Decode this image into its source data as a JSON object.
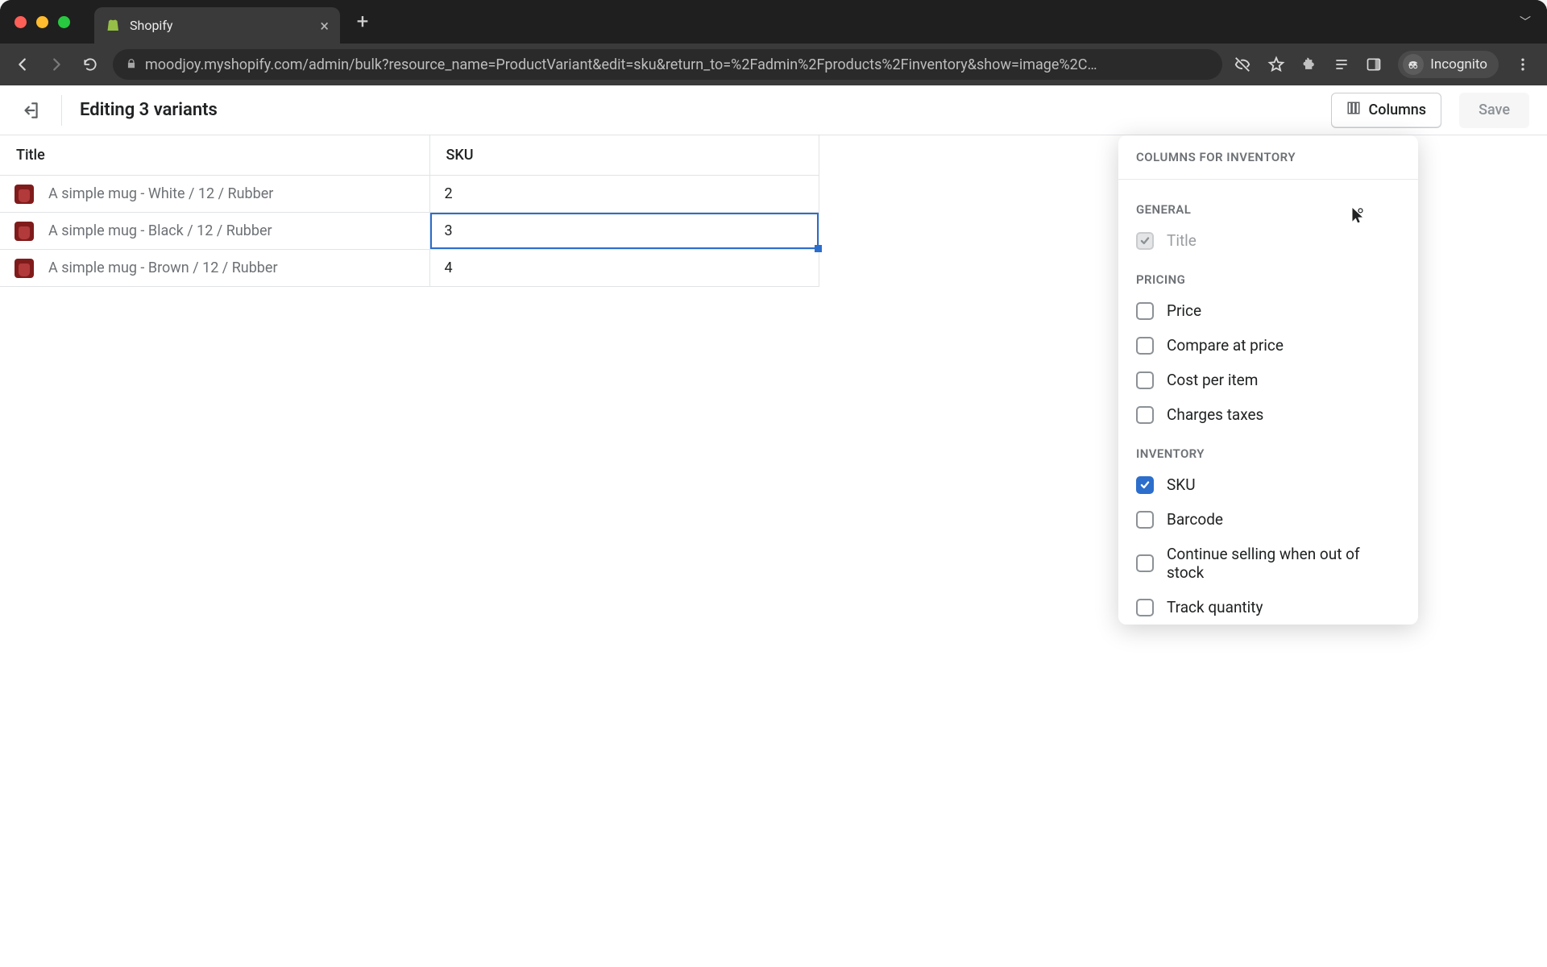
{
  "browser": {
    "tab_title": "Shopify",
    "url_display": "moodjoy.myshopify.com/admin/bulk?resource_name=ProductVariant&edit=sku&return_to=%2Fadmin%2Fproducts%2Finventory&show=image%2C…",
    "incognito_label": "Incognito"
  },
  "header": {
    "title": "Editing 3 variants",
    "columns_button": "Columns",
    "save_button": "Save"
  },
  "table": {
    "columns": {
      "title": "Title",
      "sku": "SKU"
    },
    "rows": [
      {
        "title": "A simple mug - White / 12 / Rubber",
        "sku": "2"
      },
      {
        "title": "A simple mug - Black / 12 / Rubber",
        "sku": "3"
      },
      {
        "title": "A simple mug - Brown / 12 / Rubber",
        "sku": "4"
      }
    ],
    "selected_row_index": 1
  },
  "popover": {
    "heading": "COLUMNS FOR INVENTORY",
    "sections": [
      {
        "label": "GENERAL",
        "items": [
          {
            "label": "Title",
            "checked": true,
            "disabled": true
          }
        ]
      },
      {
        "label": "PRICING",
        "items": [
          {
            "label": "Price",
            "checked": false,
            "disabled": false
          },
          {
            "label": "Compare at price",
            "checked": false,
            "disabled": false
          },
          {
            "label": "Cost per item",
            "checked": false,
            "disabled": false
          },
          {
            "label": "Charges taxes",
            "checked": false,
            "disabled": false
          }
        ]
      },
      {
        "label": "INVENTORY",
        "items": [
          {
            "label": "SKU",
            "checked": true,
            "disabled": false
          },
          {
            "label": "Barcode",
            "checked": false,
            "disabled": false
          },
          {
            "label": "Continue selling when out of stock",
            "checked": false,
            "disabled": false
          },
          {
            "label": "Track quantity",
            "checked": false,
            "disabled": false
          }
        ]
      }
    ]
  }
}
